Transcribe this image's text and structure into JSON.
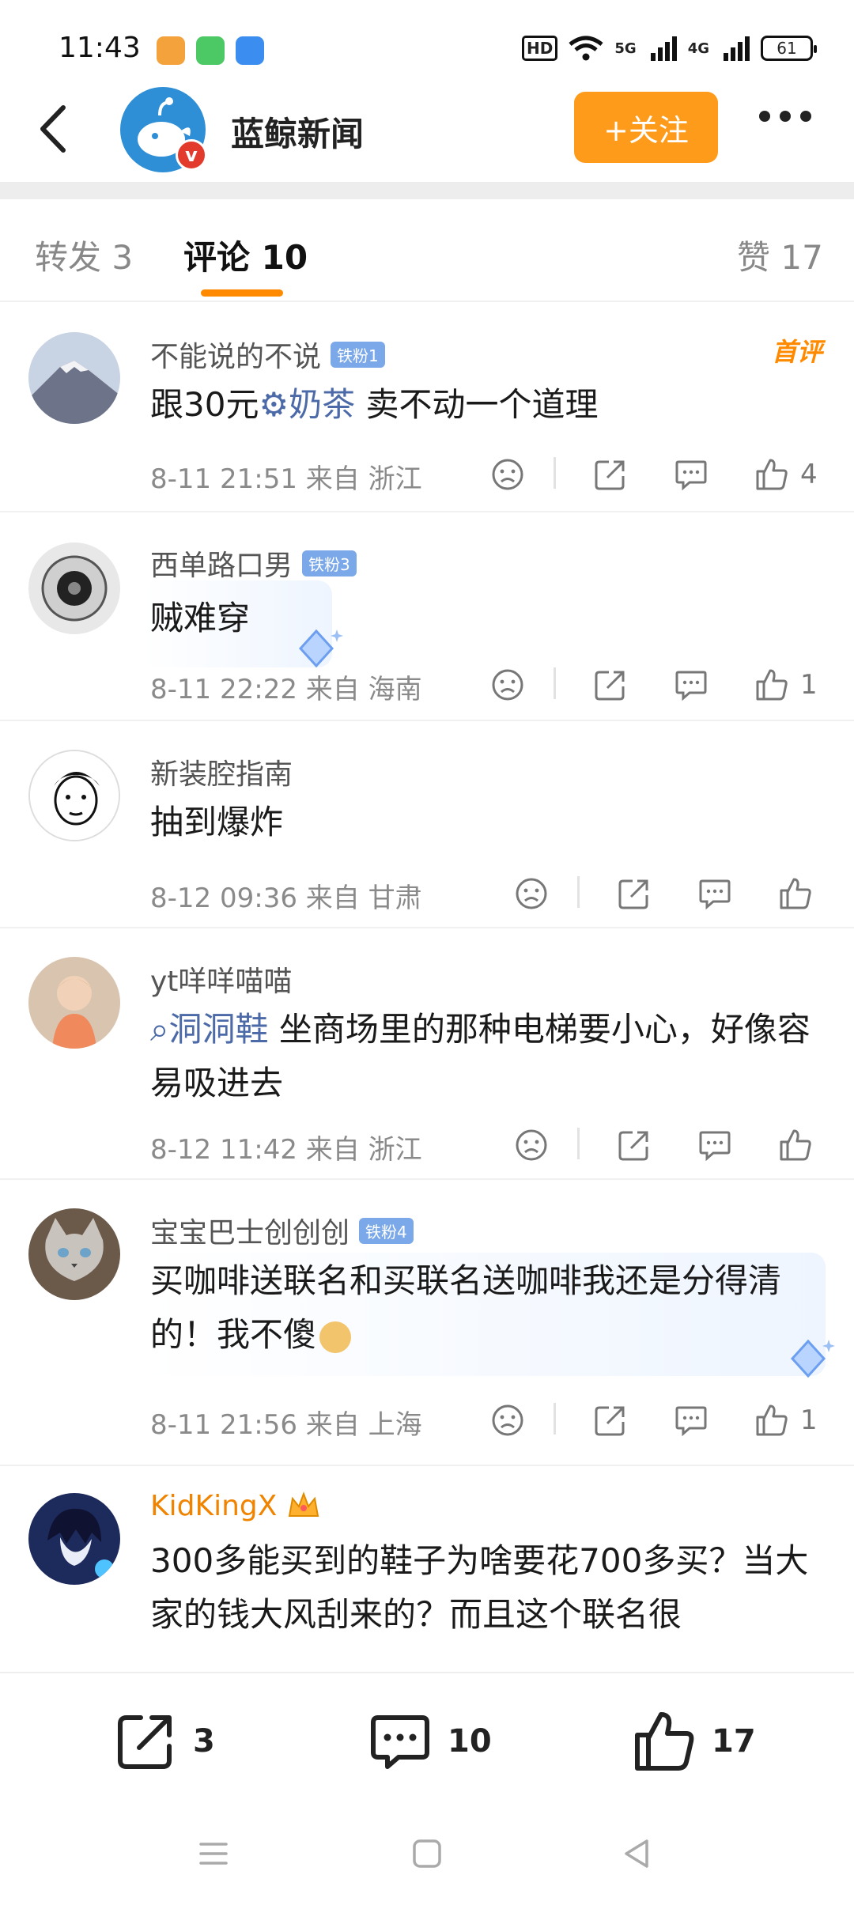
{
  "status_bar": {
    "time": "11:43",
    "network_1": "5G",
    "network_2": "4G",
    "hd_label": "HD",
    "battery": "61"
  },
  "header": {
    "account_name": "蓝鲸新闻",
    "verified_badge": "v",
    "follow_label": "+关注"
  },
  "tabs": [
    {
      "label": "转发 3"
    },
    {
      "label": "评论 10"
    },
    {
      "label": "赞 17"
    }
  ],
  "comments": [
    {
      "user": "不能说的不说",
      "fan_badge": "铁粉1",
      "first_comment_badge": "首评",
      "prefix": "跟30元",
      "link": "奶茶",
      "text": " 卖不动一个道理",
      "time": "8-11 21:51",
      "location": "来自 浙江",
      "likes": "4"
    },
    {
      "user": "西单路口男",
      "fan_badge": "铁粉3",
      "text": "贼难穿",
      "time": "8-11 22:22",
      "location": "来自 海南",
      "likes": "1"
    },
    {
      "user": "新装腔指南",
      "text": "抽到爆炸",
      "time": "8-12 09:36",
      "location": "来自 甘肃",
      "likes": ""
    },
    {
      "user": "yt咩咩喵喵",
      "link": "洞洞鞋",
      "text": " 坐商场里的那种电梯要小心，好像容易吸进去",
      "time": "8-12 11:42",
      "location": "来自 浙江",
      "likes": ""
    },
    {
      "user": "宝宝巴士创创创",
      "fan_badge": "铁粉4",
      "text": "买咖啡送联名和买联名送咖啡我还是分得清的！我不傻",
      "time": "8-11 21:56",
      "location": "来自 上海",
      "likes": "1"
    },
    {
      "user": "KidKingX",
      "text": "300多能买到的鞋子为啥要花700多买？当大家的钱大风刮来的？而且这个联名很"
    }
  ],
  "bottom_bar": {
    "repost_count": "3",
    "comment_count": "10",
    "like_count": "17"
  },
  "colors": {
    "accent": "#ff9b1a",
    "tab_indicator": "#ff8a00",
    "link": "#4c6aa8",
    "vip_name": "#f08400"
  }
}
